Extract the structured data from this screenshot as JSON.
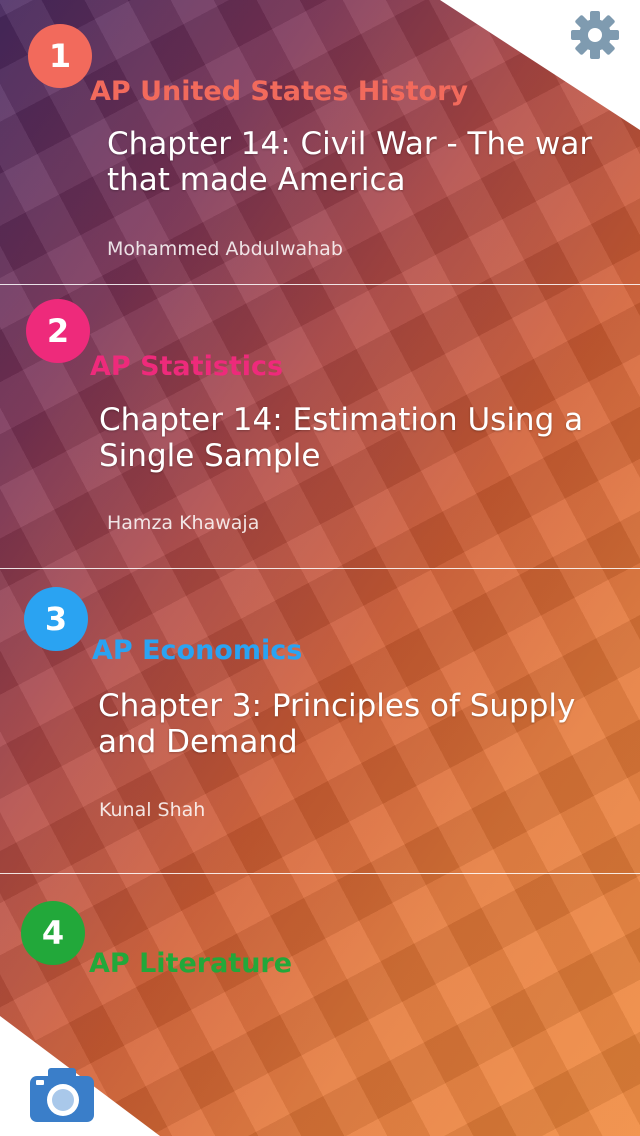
{
  "colors": {
    "badge_1": "#f26a5c",
    "badge_2": "#ee2a7b",
    "badge_3": "#2aa3f2",
    "badge_4": "#22a83a",
    "settings_icon": "#7f9bb0",
    "camera_icon": "#3a7ec9"
  },
  "icons": {
    "settings": "gear-icon",
    "camera": "camera-icon"
  },
  "courses": [
    {
      "number": "1",
      "subject": "AP United States History",
      "title": "Chapter 14: Civil War - The war that made America",
      "author": "Mohammed Abdulwahab"
    },
    {
      "number": "2",
      "subject": "AP Statistics",
      "title": "Chapter 14: Estimation Using a Single Sample",
      "author": "Hamza Khawaja"
    },
    {
      "number": "3",
      "subject": "AP Economics",
      "title": "Chapter 3: Principles of Supply and Demand",
      "author": "Kunal Shah"
    },
    {
      "number": "4",
      "subject": "AP Literature"
    }
  ]
}
